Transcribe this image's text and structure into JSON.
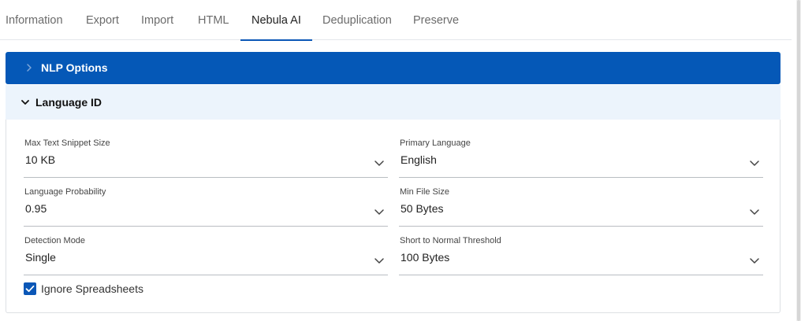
{
  "tabs": [
    {
      "label": "Information"
    },
    {
      "label": "Export"
    },
    {
      "label": "Import"
    },
    {
      "label": "HTML"
    },
    {
      "label": "Nebula AI",
      "active": true
    },
    {
      "label": "Deduplication"
    },
    {
      "label": "Preserve"
    }
  ],
  "sections": {
    "nlp": {
      "title": "NLP Options",
      "expanded": false
    },
    "language_id": {
      "title": "Language ID",
      "expanded": true
    }
  },
  "fields": {
    "max_snippet": {
      "label": "Max Text Snippet Size",
      "value": "10 KB"
    },
    "primary_language": {
      "label": "Primary Language",
      "value": "English"
    },
    "language_probability": {
      "label": "Language Probability",
      "value": "0.95"
    },
    "min_file_size": {
      "label": "Min File Size",
      "value": "50 Bytes"
    },
    "detection_mode": {
      "label": "Detection Mode",
      "value": "Single"
    },
    "short_threshold": {
      "label": "Short to Normal Threshold",
      "value": "100 Bytes"
    }
  },
  "ignore_spreadsheets": {
    "label": "Ignore Spreadsheets",
    "checked": true
  },
  "icons": {
    "collapsed": "chevron-right-icon",
    "expanded": "chevron-down-icon",
    "dropdown": "chevron-down-icon",
    "checkbox": "checkmark-icon"
  },
  "colors": {
    "accent": "#0558b7",
    "section_header_bg": "#ecf4fc",
    "tab_underline": "#0b57b7"
  }
}
